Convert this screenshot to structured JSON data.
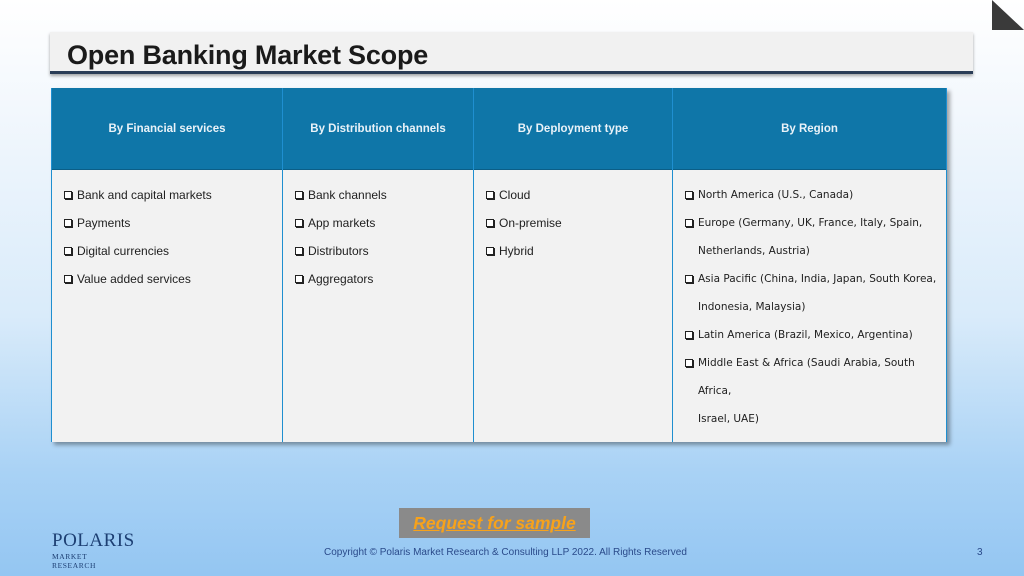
{
  "slide": {
    "title": "Open Banking Market Scope",
    "page_number": "3"
  },
  "table": {
    "columns": [
      {
        "header": "By Financial services",
        "items": [
          "Bank and capital markets",
          "Payments",
          "Digital currencies",
          "Value added services"
        ]
      },
      {
        "header": "By Distribution channels",
        "items": [
          "Bank channels",
          "App markets",
          "Distributors",
          "Aggregators"
        ]
      },
      {
        "header": "By Deployment type",
        "items": [
          "Cloud",
          "On-premise",
          "Hybrid"
        ]
      },
      {
        "header": "By Region",
        "items": [
          {
            "line1": "North America (U.S., Canada)"
          },
          {
            "line1": "Europe (Germany, UK, France, Italy, Spain,",
            "line2": "Netherlands, Austria)"
          },
          {
            "line1": "Asia Pacific (China, India, Japan, South Korea,",
            "line2": "Indonesia, Malaysia)"
          },
          {
            "line1": "Latin America (Brazil, Mexico, Argentina)"
          },
          {
            "line1": "Middle East & Africa (Saudi Arabia, South Africa,",
            "line2": "Israel, UAE)"
          }
        ]
      }
    ]
  },
  "cta": {
    "label": "Request for sample"
  },
  "footer": {
    "copyright": "Copyright © Polaris Market Research & Consulting LLP 2022. All Rights Reserved",
    "logo_name": "POLARIS",
    "logo_sub": "MARKET RESEARCH"
  },
  "colors": {
    "header_bg": "#0f76a8",
    "title_underline": "#2a3d57",
    "cta_text": "#f7a21b",
    "cta_bg": "#8a8a8a"
  },
  "icons": [
    "corner-fold-icon",
    "checkbox-bullet-icon",
    "polaris-star-icon"
  ]
}
